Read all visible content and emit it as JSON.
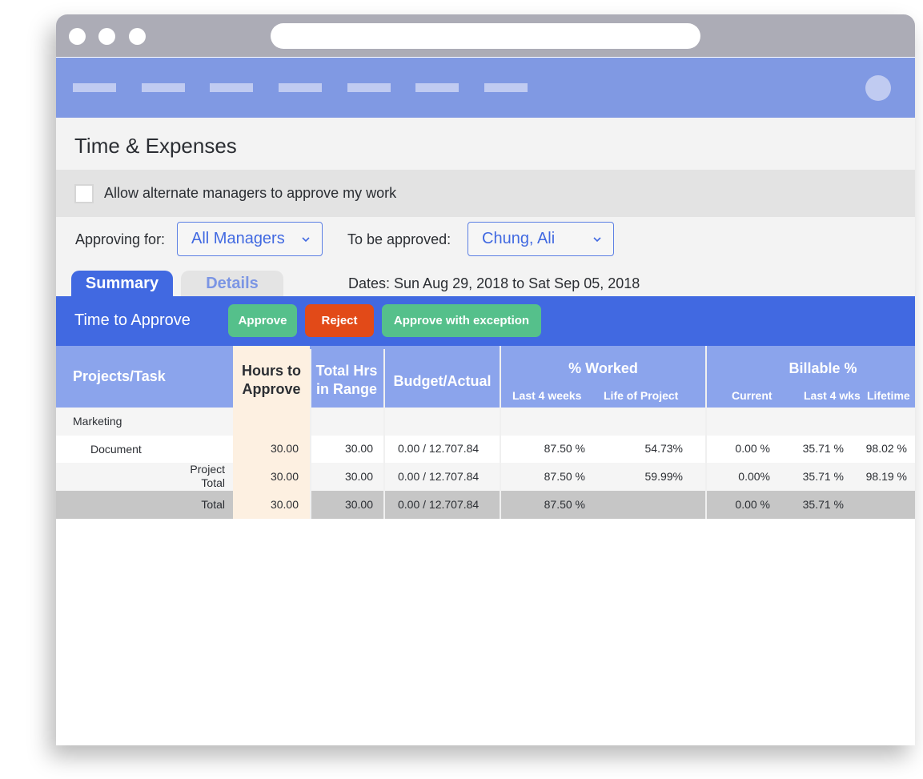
{
  "browser": {
    "window_dots": [
      "close",
      "minimize",
      "maximize"
    ]
  },
  "navbar": {
    "items": [
      "",
      "",
      "",
      "",
      "",
      "",
      ""
    ],
    "avatar_icon": "user-avatar-placeholder"
  },
  "page": {
    "title": "Time & Expenses"
  },
  "settings": {
    "allow_alternate_label": "Allow alternate managers to approve my work",
    "allow_alternate_checked": false
  },
  "filters": {
    "approving_for_label": "Approving for:",
    "approving_for_value": "All Managers",
    "to_be_approved_label": "To be approved:",
    "to_be_approved_value": "Chung, Ali"
  },
  "tabs": [
    {
      "label": "Summary",
      "active": true
    },
    {
      "label": "Details",
      "active": false
    }
  ],
  "dates_label": "Dates: Sun Aug 29, 2018 to Sat Sep 05, 2018",
  "actionbar": {
    "title": "Time to Approve",
    "approve_label": "Approve",
    "reject_label": "Reject",
    "exception_label": "Approve with exception",
    "approve_color": "#55c08b",
    "reject_color": "#e24a18",
    "bar_color": "#4169e1"
  },
  "table": {
    "headers": {
      "project_task": "Projects/Task",
      "hours_to_approve_1": "Hours to",
      "hours_to_approve_2": "Approve",
      "total_hrs_1": "Total Hrs",
      "total_hrs_2": "in Range",
      "budget_actual": "Budget/Actual",
      "pct_worked": "% Worked",
      "pct_worked_sub": [
        "Last 4 weeks",
        "Life of Project"
      ],
      "billable": "Billable %",
      "billable_sub": [
        "Current",
        "Last 4 wks",
        "Lifetime"
      ]
    },
    "rows": [
      {
        "name": "Marketing",
        "hours": "",
        "total": "",
        "budget": "",
        "w4": "",
        "wlife": "",
        "bcur": "",
        "b4": "",
        "blife": ""
      },
      {
        "name": "Document",
        "hours": "30.00",
        "total": "30.00",
        "budget": "0.00 / 12.707.84",
        "w4": "87.50 %",
        "wlife": "54.73%",
        "bcur": "0.00 %",
        "b4": "35.71 %",
        "blife": "98.02 %"
      },
      {
        "name_1": "Project",
        "name_2": "Total",
        "hours": "30.00",
        "total": "30.00",
        "budget": "0.00 / 12.707.84",
        "w4": "87.50 %",
        "wlife": "59.99%",
        "bcur": "0.00%",
        "b4": "35.71 %",
        "blife": "98.19 %"
      },
      {
        "name": "Total",
        "hours": "30.00",
        "total": "30.00",
        "budget": "0.00 / 12.707.84",
        "w4": "87.50 %",
        "wlife": "",
        "bcur": "0.00 %",
        "b4": "35.71 %",
        "blife": ""
      }
    ]
  }
}
